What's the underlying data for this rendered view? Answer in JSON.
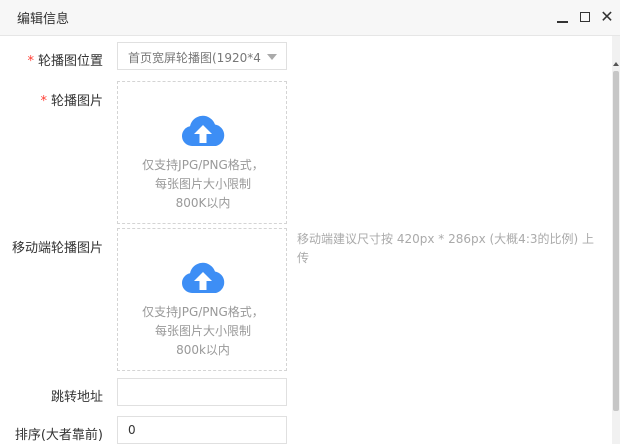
{
  "dialog": {
    "title": "编辑信息",
    "controls": {
      "minimize_icon": "minimize-icon",
      "maximize_icon": "maximize-icon",
      "close_icon": "close-icon",
      "close_glyph": "✕"
    }
  },
  "form": {
    "position": {
      "label": "轮播图位置",
      "value": "首页宽屏轮播图(1920*4",
      "required": true
    },
    "image": {
      "label": "轮播图片",
      "required": true,
      "hint": "仅支持JPG/PNG格式，每张图片大小限制800K以内"
    },
    "mobile_image": {
      "label": "移动端轮播图片",
      "hint": "仅支持JPG/PNG格式，每张图片大小限制800k以内",
      "note": "移动端建议尺寸按 420px * 286px (大概4:3的比例) 上传"
    },
    "link": {
      "label": "跳转地址",
      "value": ""
    },
    "order": {
      "label": "排序(大者靠前)",
      "value": "0"
    }
  },
  "colors": {
    "accent": "#3d8ef5",
    "required": "#ff3b30",
    "hint": "#999999"
  }
}
